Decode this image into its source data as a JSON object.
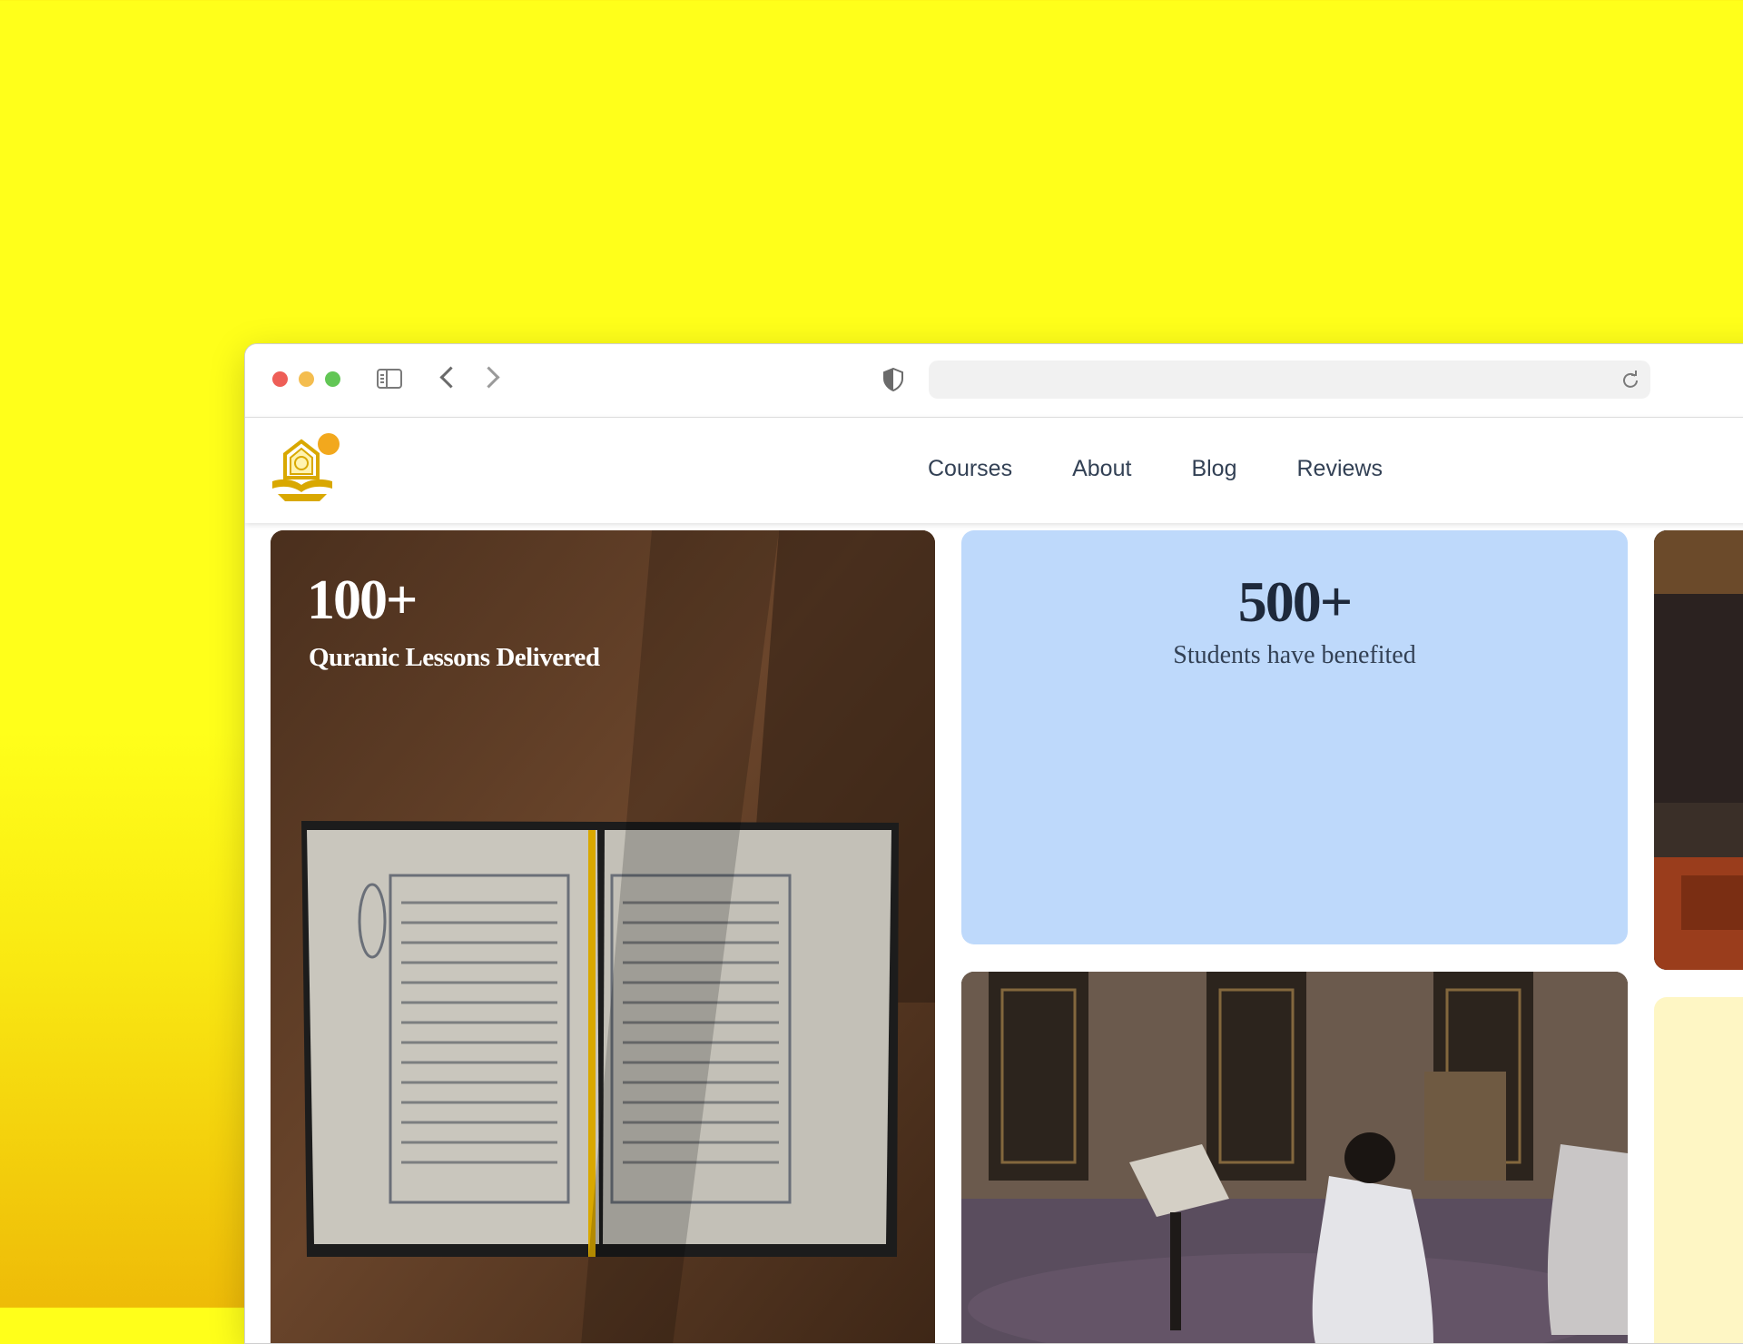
{
  "browser": {
    "url": ""
  },
  "nav": {
    "links": [
      {
        "label": "Courses"
      },
      {
        "label": "About"
      },
      {
        "label": "Blog"
      },
      {
        "label": "Reviews"
      }
    ]
  },
  "stats": {
    "lessons": {
      "value": "100+",
      "label": "Quranic Lessons Delivered"
    },
    "students": {
      "value": "500+",
      "label": "Students have benefited"
    }
  },
  "colors": {
    "background": "#ffff1a",
    "students_card": "#bed9fb",
    "cream_card": "#fef6c4",
    "logo": "#d9a800"
  }
}
